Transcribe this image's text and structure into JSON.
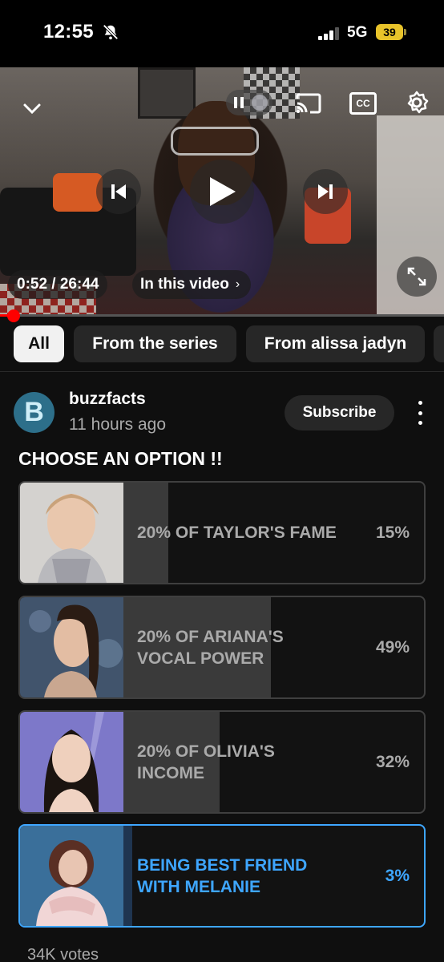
{
  "status_bar": {
    "time": "12:55",
    "network": "5G",
    "battery": "39",
    "battery_color": "#e8c32a"
  },
  "player": {
    "current_time": "0:52",
    "duration": "26:44",
    "time_display": "0:52 / 26:44",
    "chapters_label": "In this video",
    "cc_label": "CC",
    "progress_fraction": 0.033,
    "progress_color": "#ff0000"
  },
  "filters": {
    "chips": [
      {
        "label": "All",
        "active": true
      },
      {
        "label": "From the series",
        "active": false
      },
      {
        "label": "From alissa jadyn",
        "active": false
      }
    ]
  },
  "post": {
    "channel_initial": "B",
    "channel_name": "buzzfacts",
    "posted_ago": "11 hours ago",
    "subscribe_label": "Subscribe",
    "question": "CHOOSE AN OPTION !!",
    "options": [
      {
        "label": "20% OF TAYLOR'S FAME",
        "percent": "15%",
        "value": 15,
        "selected": false
      },
      {
        "label": "20% OF ARIANA'S VOCAL POWER",
        "percent": "49%",
        "value": 49,
        "selected": false
      },
      {
        "label": "20% OF OLIVIA'S INCOME",
        "percent": "32%",
        "value": 32,
        "selected": false
      },
      {
        "label": "BEING BEST FRIEND WITH MELANIE",
        "percent": "3%",
        "value": 3,
        "selected": true
      }
    ],
    "votes": "34K votes",
    "accent_color": "#3ea6ff"
  },
  "icons": {
    "status": [
      "bell-off-icon",
      "signal-icon",
      "battery-icon"
    ],
    "player": [
      "chevron-down-icon",
      "pause-icon",
      "cast-icon",
      "cc-icon",
      "gear-icon",
      "previous-icon",
      "play-icon",
      "next-icon",
      "fullscreen-icon"
    ]
  }
}
